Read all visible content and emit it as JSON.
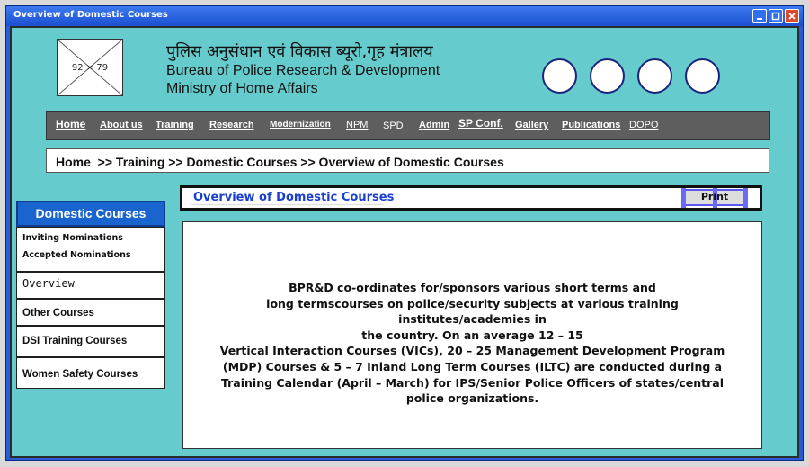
{
  "window": {
    "title": "Overview of Domestic Courses"
  },
  "header": {
    "logo_placeholder": "92 × 79",
    "hindi_name": "पुलिस अनुसंधान एवं विकास ब्यूरो,गृह मंत्रालय",
    "english_name": "Bureau of Police Research & Development",
    "ministry": "Ministry of Home Affairs"
  },
  "nav": [
    {
      "label": "Home"
    },
    {
      "label": "About us"
    },
    {
      "label": "Training"
    },
    {
      "label": "Research"
    },
    {
      "label": "Modernization"
    },
    {
      "label": "NPM"
    },
    {
      "label": "SPD"
    },
    {
      "label": "Admin"
    },
    {
      "label": "SP Conf."
    },
    {
      "label": "Gallery"
    },
    {
      "label": "Publications"
    },
    {
      "label": "DOPO"
    }
  ],
  "breadcrumb": "Home  >> Training >> Domestic Courses >> Overview of Domestic Courses",
  "sidebar": {
    "heading": "Domestic Courses",
    "items": [
      {
        "label": "Inviting Nominations"
      },
      {
        "label": "Accepted Nominations"
      },
      {
        "label": "Overview"
      },
      {
        "label": "Other Courses"
      },
      {
        "label": "DSI Training Courses"
      },
      {
        "label": "Women Safety Courses"
      }
    ]
  },
  "content": {
    "title": "Overview of Domestic Courses",
    "print_label": "Print",
    "lines": [
      "BPR&D co-ordinates for/sponsors various short terms and",
      "long termscourses on police/security subjects at various training institutes/academies in",
      "the country. On an average 12 – 15",
      "Vertical Interaction Courses (VICs), 20 – 25 Management Development Program",
      "(MDP) Courses & 5 – 7 Inland Long Term Courses (ILTC) are conducted during a",
      "Training Calendar (April – March) for IPS/Senior Police Officers of states/central",
      "police organizations."
    ]
  }
}
